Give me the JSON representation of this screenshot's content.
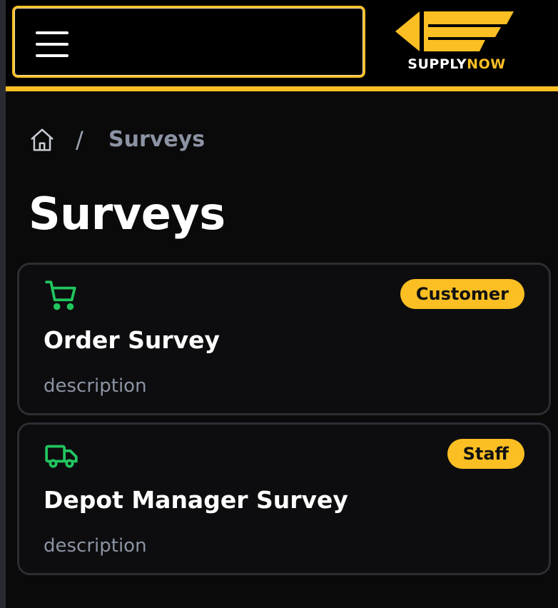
{
  "header": {
    "menu_icon": "hamburger-icon",
    "logo": {
      "text_primary": "SUPPLY",
      "text_accent": "NOW"
    }
  },
  "colors": {
    "accent": "#fbbf24",
    "background": "#0a0a0b",
    "icon_green": "#22c55e",
    "muted_text": "#8c93a3"
  },
  "breadcrumb": {
    "home_icon": "home-icon",
    "separator": "/",
    "current": "Surveys"
  },
  "page": {
    "title": "Surveys"
  },
  "surveys": [
    {
      "icon": "shopping-cart-icon",
      "badge": "Customer",
      "title": "Order Survey",
      "description": "description"
    },
    {
      "icon": "truck-icon",
      "badge": "Staff",
      "title": "Depot Manager Survey",
      "description": "description"
    }
  ]
}
